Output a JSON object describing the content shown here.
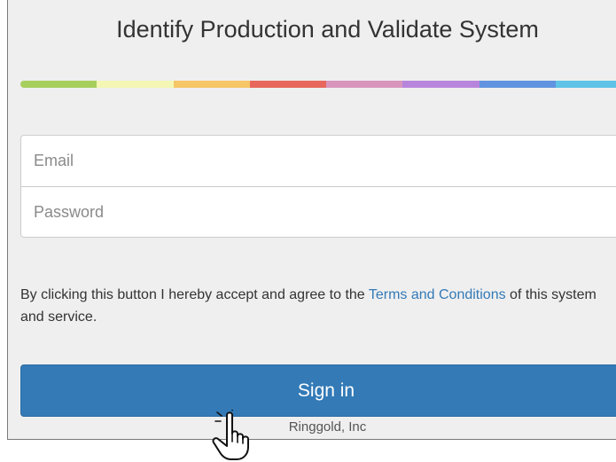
{
  "login": {
    "title": "Identify Production and Validate System",
    "stripe_colors": [
      "#a7cf5e",
      "#f3f7b3",
      "#f6c667",
      "#e8675c",
      "#d896bd",
      "#b885dc",
      "#6193e0",
      "#5ec3e6"
    ],
    "email_placeholder": "Email",
    "password_placeholder": "Password",
    "terms_prefix": "By clicking this button I hereby accept and agree to the ",
    "terms_link": "Terms and Conditions",
    "terms_suffix": " of this system and service.",
    "signin_label": "Sign in",
    "footer": "Ringgold, Inc"
  },
  "cursor": {
    "icon": "hand-pointer-icon"
  }
}
